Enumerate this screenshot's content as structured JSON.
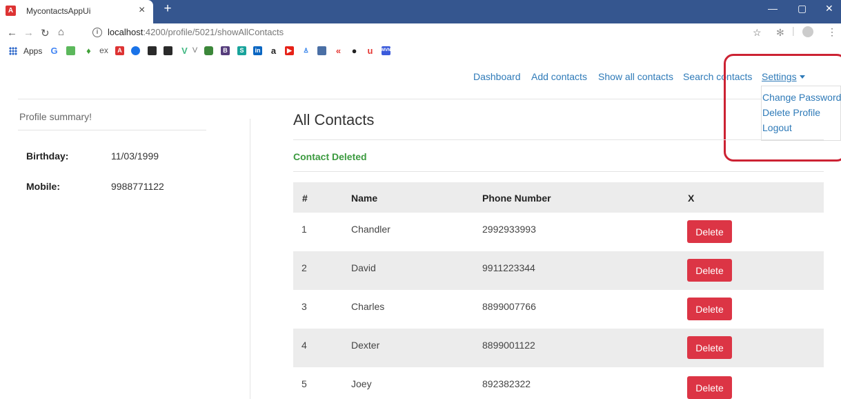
{
  "browser": {
    "tab_title": "MycontactsAppUi",
    "tab_close": "×",
    "new_tab": "+",
    "url_host": "localhost",
    "url_path": ":4200/profile/5021/showAllContacts",
    "bookmarks_apps_label": "Apps"
  },
  "nav": {
    "dashboard": "Dashboard",
    "add_contacts": "Add contacts",
    "show_all_contacts": "Show all contacts",
    "search_contacts": "Search contacts",
    "settings": "Settings",
    "dropdown": [
      "Change Password",
      "Delete Profile",
      "Logout"
    ]
  },
  "profile": {
    "title": "Profile summary!",
    "fields": [
      {
        "label": "Birthday:",
        "value": "11/03/1999"
      },
      {
        "label": "Mobile:",
        "value": "9988771122"
      }
    ]
  },
  "main": {
    "title": "All Contacts",
    "status": "Contact Deleted",
    "columns": [
      "#",
      "Name",
      "Phone Number",
      "X"
    ],
    "rows": [
      {
        "id": "1",
        "name": "Chandler",
        "phone": "2992933993",
        "action": "Delete"
      },
      {
        "id": "2",
        "name": "David",
        "phone": "9911223344",
        "action": "Delete"
      },
      {
        "id": "3",
        "name": "Charles",
        "phone": "8899007766",
        "action": "Delete"
      },
      {
        "id": "4",
        "name": "Dexter",
        "phone": "8899001122",
        "action": "Delete"
      },
      {
        "id": "5",
        "name": "Joey",
        "phone": "892382322",
        "action": "Delete"
      }
    ]
  },
  "colors": {
    "link": "#2e7ab8",
    "delete": "#dc3545",
    "success": "#3b9a3f",
    "highlight": "#cc2233",
    "chrome": "#35568f"
  }
}
